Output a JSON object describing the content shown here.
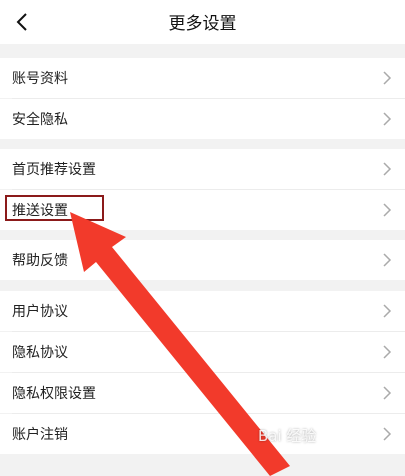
{
  "header": {
    "title": "更多设置",
    "back_icon": "chevron-left-icon"
  },
  "groups": [
    {
      "items": [
        {
          "label": "账号资料",
          "name": "account-info"
        },
        {
          "label": "安全隐私",
          "name": "security-privacy"
        }
      ]
    },
    {
      "items": [
        {
          "label": "首页推荐设置",
          "name": "home-recommend-settings"
        },
        {
          "label": "推送设置",
          "name": "push-settings"
        }
      ]
    },
    {
      "items": [
        {
          "label": "帮助反馈",
          "name": "help-feedback"
        }
      ]
    },
    {
      "items": [
        {
          "label": "用户协议",
          "name": "user-agreement"
        },
        {
          "label": "隐私协议",
          "name": "privacy-agreement"
        },
        {
          "label": "隐私权限设置",
          "name": "privacy-permission-settings"
        },
        {
          "label": "账户注销",
          "name": "account-deactivation"
        }
      ]
    }
  ],
  "annotation": {
    "highlight_color": "#8b1a1a",
    "arrow_color": "#f23a2b"
  },
  "watermark": {
    "text": "Bai 经验"
  }
}
